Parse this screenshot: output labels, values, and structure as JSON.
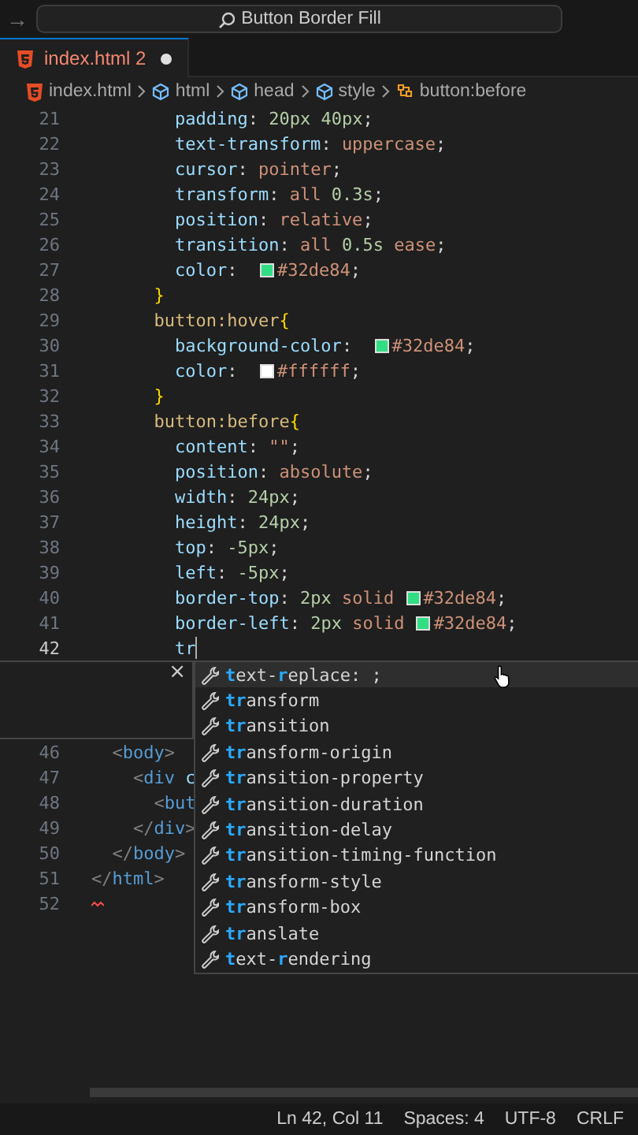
{
  "title_bar": {
    "back_arrow": "→",
    "search": "Button Border Fill"
  },
  "tabs": [
    {
      "label": "index.html",
      "problems": "2",
      "modified": true,
      "selected": true
    }
  ],
  "breadcrumbs": [
    {
      "label": "index.html",
      "kind": "file"
    },
    {
      "label": "html",
      "kind": "element"
    },
    {
      "label": "head",
      "kind": "element"
    },
    {
      "label": "style",
      "kind": "element"
    },
    {
      "label": "button:before",
      "kind": "rule"
    }
  ],
  "editor": {
    "lines": [
      {
        "number": "21",
        "current": false,
        "segments": [
          {
            "kind": "code",
            "text": "        padding: 20px 40px;"
          }
        ]
      },
      {
        "number": "22",
        "current": false,
        "segments": [
          {
            "kind": "code",
            "text": "        text-transform: uppercase;"
          }
        ]
      },
      {
        "number": "23",
        "current": false,
        "segments": [
          {
            "kind": "code",
            "text": "        cursor: pointer;"
          }
        ]
      },
      {
        "number": "24",
        "current": false,
        "segments": [
          {
            "kind": "code",
            "text": "        transform: all 0.3s;"
          }
        ]
      },
      {
        "number": "25",
        "current": false,
        "segments": [
          {
            "kind": "code",
            "text": "        position: relative;"
          }
        ]
      },
      {
        "number": "26",
        "current": false,
        "segments": [
          {
            "kind": "code",
            "text": "        transition: all 0.5s ease;"
          }
        ]
      },
      {
        "number": "27",
        "current": false,
        "segments": [
          {
            "kind": "code",
            "text": "        color: "
          },
          {
            "kind": "swatch",
            "color": "#32de84"
          },
          {
            "kind": "code",
            "text": "#32de84;"
          }
        ]
      },
      {
        "number": "28",
        "current": false,
        "segments": [
          {
            "kind": "code",
            "text": "      }"
          }
        ]
      },
      {
        "number": "29",
        "current": false,
        "segments": [
          {
            "kind": "code",
            "text": "      button:hover{"
          }
        ]
      },
      {
        "number": "30",
        "current": false,
        "segments": [
          {
            "kind": "code",
            "text": "        background-color: "
          },
          {
            "kind": "swatch",
            "color": "#32de84"
          },
          {
            "kind": "code",
            "text": "#32de84;"
          }
        ]
      },
      {
        "number": "31",
        "current": false,
        "segments": [
          {
            "kind": "code",
            "text": "        color: "
          },
          {
            "kind": "swatch",
            "color": "#ffffff"
          },
          {
            "kind": "code",
            "text": "#ffffff;"
          }
        ]
      },
      {
        "number": "32",
        "current": false,
        "segments": [
          {
            "kind": "code",
            "text": "      }"
          }
        ]
      },
      {
        "number": "33",
        "current": false,
        "segments": [
          {
            "kind": "code",
            "text": "      button:before{"
          }
        ]
      },
      {
        "number": "34",
        "current": false,
        "segments": [
          {
            "kind": "code",
            "text": "        content: \"\";"
          }
        ]
      },
      {
        "number": "35",
        "current": false,
        "segments": [
          {
            "kind": "code",
            "text": "        position: absolute;"
          }
        ]
      },
      {
        "number": "36",
        "current": false,
        "segments": [
          {
            "kind": "code",
            "text": "        width: 24px;"
          }
        ]
      },
      {
        "number": "37",
        "current": false,
        "segments": [
          {
            "kind": "code",
            "text": "        height: 24px;"
          }
        ]
      },
      {
        "number": "38",
        "current": false,
        "segments": [
          {
            "kind": "code",
            "text": "        top: -5px;"
          }
        ]
      },
      {
        "number": "39",
        "current": false,
        "segments": [
          {
            "kind": "code",
            "text": "        left: -5px;"
          }
        ]
      },
      {
        "number": "40",
        "current": false,
        "segments": [
          {
            "kind": "code",
            "text": "        border-top: 2px solid "
          },
          {
            "kind": "swatch",
            "color": "#32de84"
          },
          {
            "kind": "code",
            "text": "#32de84;"
          }
        ]
      },
      {
        "number": "41",
        "current": false,
        "segments": [
          {
            "kind": "code",
            "text": "        border-left: 2px solid "
          },
          {
            "kind": "swatch",
            "color": "#32de84"
          },
          {
            "kind": "code",
            "text": "#32de84;"
          }
        ]
      },
      {
        "number": "42",
        "current": true,
        "segments": [
          {
            "kind": "code",
            "text": "        tr"
          },
          {
            "kind": "cursor"
          }
        ]
      },
      {
        "kind": "zone",
        "close": "×"
      },
      {
        "number": "46",
        "current": false,
        "segments": [
          {
            "kind": "code",
            "text": "  <body>"
          }
        ]
      },
      {
        "number": "47",
        "current": false,
        "segments": [
          {
            "kind": "code",
            "text": "    <div c"
          }
        ]
      },
      {
        "number": "48",
        "current": false,
        "segments": [
          {
            "kind": "code",
            "text": "      <but"
          }
        ]
      },
      {
        "number": "49",
        "current": false,
        "segments": [
          {
            "kind": "code",
            "text": "    </div>"
          }
        ]
      },
      {
        "number": "50",
        "current": false,
        "segments": [
          {
            "kind": "code",
            "text": "  </body>"
          }
        ]
      },
      {
        "number": "51",
        "current": false,
        "segments": [
          {
            "kind": "code",
            "text": "</html>"
          }
        ]
      },
      {
        "number": "52",
        "current": false,
        "segments": [
          {
            "kind": "squiggle"
          }
        ]
      }
    ]
  },
  "suggestions": [
    {
      "selected": true,
      "label": "**t**ext-**r**eplace: ;"
    },
    {
      "selected": false,
      "label": "**tr**ansform"
    },
    {
      "selected": false,
      "label": "**tr**ansition"
    },
    {
      "selected": false,
      "label": "**tr**ansform-origin"
    },
    {
      "selected": false,
      "label": "**tr**ansition-property"
    },
    {
      "selected": false,
      "label": "**tr**ansition-duration"
    },
    {
      "selected": false,
      "label": "**tr**ansition-delay"
    },
    {
      "selected": false,
      "label": "**tr**ansition-timing-function"
    },
    {
      "selected": false,
      "label": "**tr**ansform-style"
    },
    {
      "selected": false,
      "label": "**tr**ansform-box"
    },
    {
      "selected": false,
      "label": "**tr**anslate"
    },
    {
      "selected": false,
      "label": "**t**ext-**r**endering"
    }
  ],
  "status_bar": [
    "Ln 42, Col 11",
    "Spaces: 4",
    "UTF-8",
    "CRLF"
  ]
}
